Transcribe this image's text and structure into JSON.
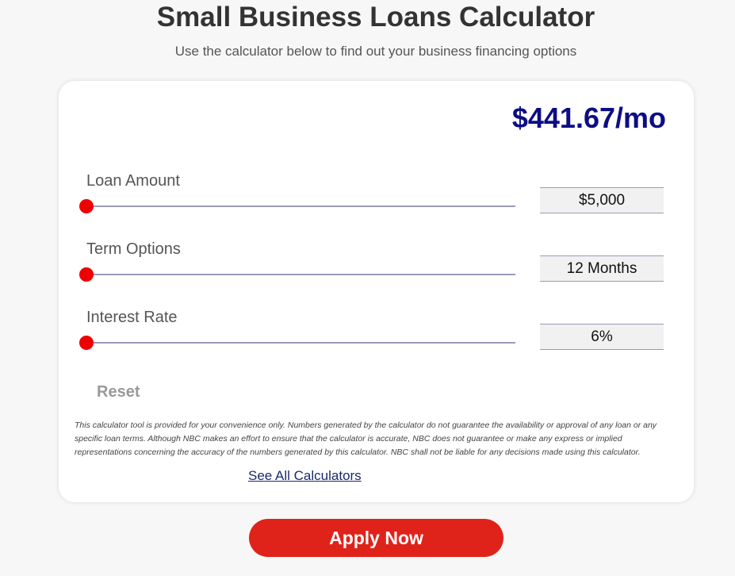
{
  "header": {
    "title": "Small Business Loans Calculator",
    "subtitle": "Use the calculator below to find out your business financing options"
  },
  "calculator": {
    "payment": "$441.67/mo",
    "fields": [
      {
        "label": "Loan Amount",
        "value": "$5,000"
      },
      {
        "label": "Term Options",
        "value": "12 Months"
      },
      {
        "label": "Interest Rate",
        "value": "6%"
      }
    ],
    "reset_label": "Reset",
    "disclaimer": "This calculator tool is provided for your convenience only. Numbers generated by the calculator do not guarantee the availability or approval of any loan or any specific loan terms. Although NBC makes an effort to ensure that the calculator is accurate, NBC does not guarantee or make any express or implied representations concerning the accuracy of the numbers generated by this calculator. NBC shall not be liable for any decisions made using this calculator.",
    "see_all_label": "See All Calculators"
  },
  "cta": {
    "apply_label": "Apply Now"
  },
  "colors": {
    "accent": "#ee0000",
    "payment": "#0d0d86",
    "apply_button": "#e0231a"
  }
}
